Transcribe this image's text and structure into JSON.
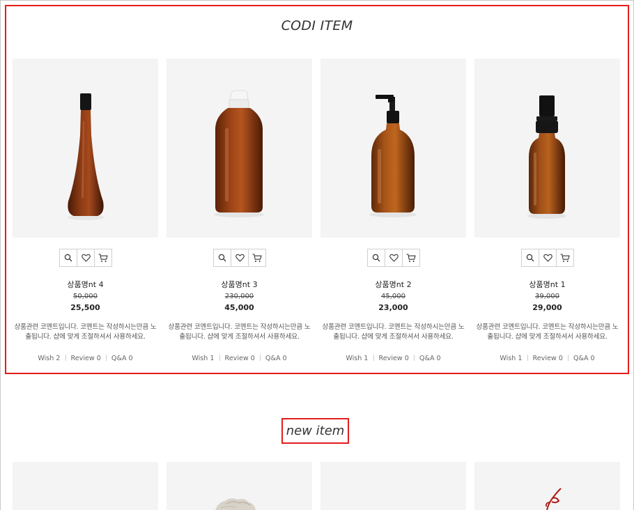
{
  "codi_section": {
    "title": "CODI ITEM",
    "products": [
      {
        "name": "상품명nt 4",
        "original_price": "50,000",
        "price": "25,500",
        "description": "상품관련 코멘트입니다. 코멘트는 작성하시는만큼 노출됩니다. 샵에 맞게 조절하셔서 사용하세요.",
        "wish": "Wish 2",
        "review": "Review 0",
        "qna": "Q&A 0",
        "image_icon": "amber-slim-bottle",
        "actions": [
          "zoom-icon",
          "heart-icon",
          "cart-icon"
        ]
      },
      {
        "name": "상품명nt 3",
        "original_price": "230,000",
        "price": "45,000",
        "description": "상품관련 코멘트입니다. 코멘트는 작성하시는만큼 노출됩니다. 샵에 맞게 조절하셔서 사용하세요.",
        "wish": "Wish 1",
        "review": "Review 0",
        "qna": "Q&A 0",
        "image_icon": "amber-flip-cap-bottle",
        "actions": [
          "zoom-icon",
          "heart-icon",
          "cart-icon"
        ]
      },
      {
        "name": "상품명nt 2",
        "original_price": "45,000",
        "price": "23,000",
        "description": "상품관련 코멘트입니다. 코멘트는 작성하시는만큼 노출됩니다. 샵에 맞게 조절하셔서 사용하세요.",
        "wish": "Wish 1",
        "review": "Review 0",
        "qna": "Q&A 0",
        "image_icon": "amber-pump-bottle",
        "actions": [
          "zoom-icon",
          "heart-icon",
          "cart-icon"
        ]
      },
      {
        "name": "상품명nt 1",
        "original_price": "39,000",
        "price": "29,000",
        "description": "상품관련 코멘트입니다. 코멘트는 작성하시는만큼 노출됩니다. 샵에 맞게 조절하셔서 사용하세요.",
        "wish": "Wish 1",
        "review": "Review 0",
        "qna": "Q&A 0",
        "image_icon": "amber-spray-bottle",
        "actions": [
          "zoom-icon",
          "heart-icon",
          "cart-icon"
        ]
      }
    ]
  },
  "new_section": {
    "title": "new item",
    "products": [
      {
        "image_icon": "blank-product-image"
      },
      {
        "image_icon": "crumpled-fabric-image"
      },
      {
        "image_icon": "blank-product-image"
      },
      {
        "image_icon": "red-string-image"
      }
    ]
  },
  "colors": {
    "highlight_border": "#e41c1c",
    "thumb_background": "#f4f4f4",
    "amber_glass": "#7a3410"
  }
}
